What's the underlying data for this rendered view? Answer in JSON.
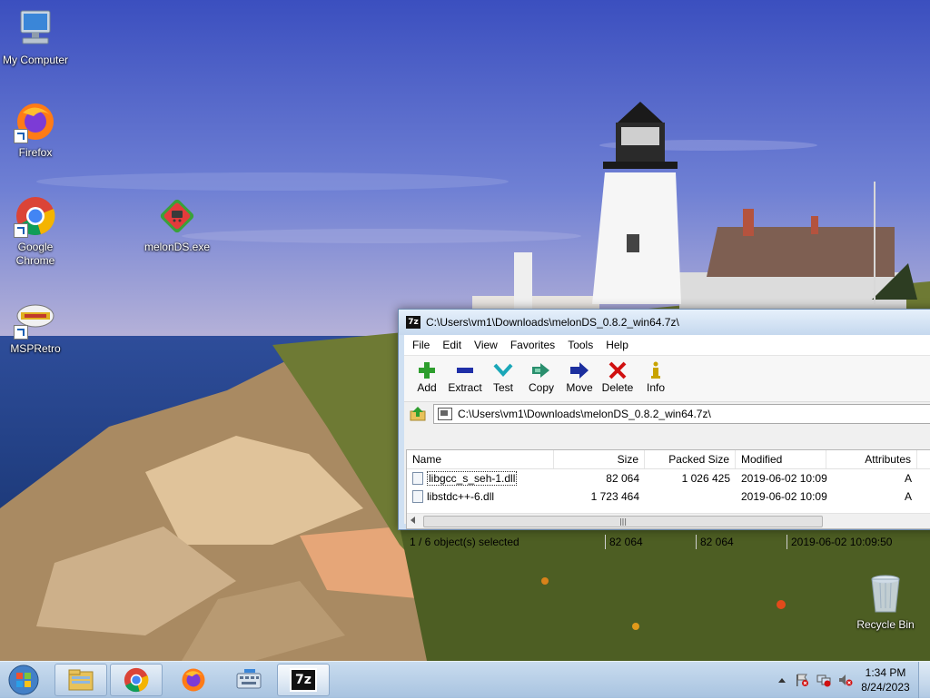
{
  "desktop": {
    "icons": [
      {
        "label": "My Computer",
        "icon": "computer-icon"
      },
      {
        "label": "Firefox",
        "icon": "firefox-icon"
      },
      {
        "label": "Google Chrome",
        "icon": "chrome-icon"
      },
      {
        "label": "melonDS.exe",
        "icon": "melonds-icon"
      },
      {
        "label": "MSPRetro",
        "icon": "mspretro-icon"
      },
      {
        "label": "Recycle Bin",
        "icon": "recycle-bin-icon"
      }
    ]
  },
  "window": {
    "title": "C:\\Users\\vm1\\Downloads\\melonDS_0.8.2_win64.7z\\",
    "menu": [
      "File",
      "Edit",
      "View",
      "Favorites",
      "Tools",
      "Help"
    ],
    "toolbar": [
      {
        "label": "Add",
        "icon": "plus-icon",
        "color": "#2e9e2e"
      },
      {
        "label": "Extract",
        "icon": "minus-icon",
        "color": "#1f2fa8"
      },
      {
        "label": "Test",
        "icon": "check-chevron-icon",
        "color": "#1aa7b8"
      },
      {
        "label": "Copy",
        "icon": "double-arrow-icon",
        "color": "#2a8f6e"
      },
      {
        "label": "Move",
        "icon": "arrow-right-icon",
        "color": "#1c2f9e"
      },
      {
        "label": "Delete",
        "icon": "x-icon",
        "color": "#d01010"
      },
      {
        "label": "Info",
        "icon": "info-icon",
        "color": "#c9a400"
      }
    ],
    "address": "C:\\Users\\vm1\\Downloads\\melonDS_0.8.2_win64.7z\\",
    "columns": [
      "Name",
      "Size",
      "Packed Size",
      "Modified",
      "Attributes"
    ],
    "rows": [
      {
        "name": "libgcc_s_seh-1.dll",
        "size": "82 064",
        "packed": "1 026 425",
        "modified": "2019-06-02 10:09",
        "attr": "A"
      },
      {
        "name": "libstdc++-6.dll",
        "size": "1 723 464",
        "packed": "",
        "modified": "2019-06-02 10:09",
        "attr": "A"
      }
    ],
    "status": {
      "selection": "1 / 6 object(s) selected",
      "size": "82 064",
      "packed": "82 064",
      "modified": "2019-06-02 10:09:50"
    }
  },
  "taskbar": {
    "time": "1:34 PM",
    "date": "8/24/2023",
    "items": [
      "start-orb-icon",
      "file-explorer-icon",
      "chrome-icon",
      "firefox-icon",
      "keyboard-icon",
      "7zip-icon"
    ],
    "seven_zip_label": "7z"
  }
}
